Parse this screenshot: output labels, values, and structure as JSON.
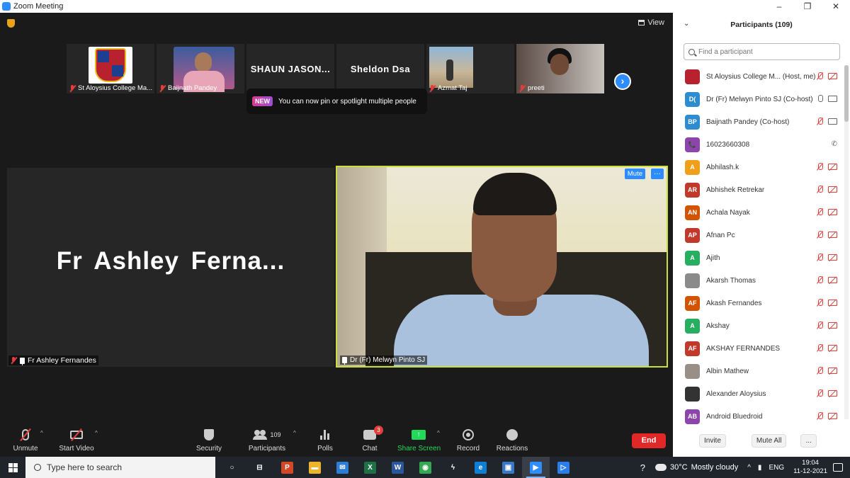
{
  "window": {
    "title": "Zoom Meeting",
    "controls": [
      "–",
      "❐",
      "✕"
    ]
  },
  "meeting": {
    "view_label": "View",
    "strip": [
      {
        "name": "St Aloysius College Ma..."
      },
      {
        "name": "Baijnath Pandey"
      },
      {
        "display_name": "SHAUN JASON..."
      },
      {
        "display_name": "Sheldon Dsa"
      },
      {
        "name": "Azmat Taj"
      },
      {
        "name": "preeti"
      }
    ],
    "tooltip": {
      "badge": "NEW",
      "text": "You can now pin or spotlight multiple people"
    },
    "left_tile": {
      "display_name": "Fr Ashley Ferna...",
      "label": "Fr Ashley Fernandes"
    },
    "right_tile": {
      "label": "Dr (Fr) Melwyn Pinto SJ",
      "mute_label": "Mute",
      "more_label": "···"
    }
  },
  "toolbar": {
    "unmute": "Unmute",
    "start_video": "Start Video",
    "security": "Security",
    "participants": "Participants",
    "participant_count": "109",
    "polls": "Polls",
    "chat": "Chat",
    "chat_badge": "3",
    "share_screen": "Share Screen",
    "record": "Record",
    "reactions": "Reactions",
    "end": "End",
    "accent_share": "#23d959",
    "accent_end": "#e02828"
  },
  "panel": {
    "title": "Participants (109)",
    "search_placeholder": "Find a participant",
    "participants": [
      {
        "initials": "",
        "color": "#b8222e",
        "name": "St Aloysius College M...",
        "role": "(Host, me)",
        "mic": "off",
        "cam": "off"
      },
      {
        "initials": "D(",
        "color": "#2d8ccf",
        "name": "Dr (Fr) Melwyn Pinto SJ",
        "role": "(Co-host)",
        "mic": "on",
        "cam": "on"
      },
      {
        "initials": "BP",
        "color": "#2d8ccf",
        "name": "Baijnath Pandey",
        "role": "(Co-host)",
        "mic": "off",
        "cam": "on"
      },
      {
        "initials": "📞",
        "color": "#8e44ad",
        "name": "16023660308",
        "role": "",
        "mic": "phone",
        "cam": "none"
      },
      {
        "initials": "A",
        "color": "#f0a018",
        "name": "Abhilash.k",
        "role": "",
        "mic": "off",
        "cam": "off"
      },
      {
        "initials": "AR",
        "color": "#c0392b",
        "name": "Abhishek Retrekar",
        "role": "",
        "mic": "off",
        "cam": "off"
      },
      {
        "initials": "AN",
        "color": "#d35400",
        "name": "Achala Nayak",
        "role": "",
        "mic": "off",
        "cam": "off"
      },
      {
        "initials": "AP",
        "color": "#c0392b",
        "name": "Afnan Pc",
        "role": "",
        "mic": "off",
        "cam": "off"
      },
      {
        "initials": "A",
        "color": "#27ae60",
        "name": "Ajith",
        "role": "",
        "mic": "off",
        "cam": "off"
      },
      {
        "initials": "",
        "color": "#8a8a8a",
        "name": "Akarsh Thomas",
        "role": "",
        "mic": "off",
        "cam": "off"
      },
      {
        "initials": "AF",
        "color": "#d35400",
        "name": "Akash Fernandes",
        "role": "",
        "mic": "off",
        "cam": "off"
      },
      {
        "initials": "A",
        "color": "#27ae60",
        "name": "Akshay",
        "role": "",
        "mic": "off",
        "cam": "off"
      },
      {
        "initials": "AF",
        "color": "#c0392b",
        "name": "AKSHAY FERNANDES",
        "role": "",
        "mic": "off",
        "cam": "off"
      },
      {
        "initials": "",
        "color": "#9a8f86",
        "name": "Albin Mathew",
        "role": "",
        "mic": "off",
        "cam": "off"
      },
      {
        "initials": "",
        "color": "#333333",
        "name": "Alexander Aloysius",
        "role": "",
        "mic": "off",
        "cam": "off"
      },
      {
        "initials": "AB",
        "color": "#8e44ad",
        "name": "Android Bluedroid",
        "role": "",
        "mic": "off",
        "cam": "off"
      }
    ],
    "invite": "Invite",
    "mute_all": "Mute All",
    "more": "..."
  },
  "taskbar": {
    "search_placeholder": "Type here to search",
    "apps": [
      {
        "glyph": "○",
        "color": "transparent"
      },
      {
        "glyph": "⊟",
        "color": "transparent"
      },
      {
        "glyph": "P",
        "color": "#d24726"
      },
      {
        "glyph": "▬",
        "color": "#f0b429"
      },
      {
        "glyph": "✉",
        "color": "#2d7cd6"
      },
      {
        "glyph": "X",
        "color": "#1e7145"
      },
      {
        "glyph": "W",
        "color": "#2b579a"
      },
      {
        "glyph": "◉",
        "color": "#34a853"
      },
      {
        "glyph": "ϟ",
        "color": "transparent"
      },
      {
        "glyph": "e",
        "color": "#0f7fd6"
      },
      {
        "glyph": "▣",
        "color": "#3b78c4"
      },
      {
        "glyph": "▶",
        "color": "#2d8cff"
      },
      {
        "glyph": "▷",
        "color": "#2b7de9"
      }
    ],
    "weather": "30°C",
    "weather_desc": "Mostly cloudy",
    "lang": "ENG",
    "time": "19:04",
    "date": "11-12-2021"
  }
}
